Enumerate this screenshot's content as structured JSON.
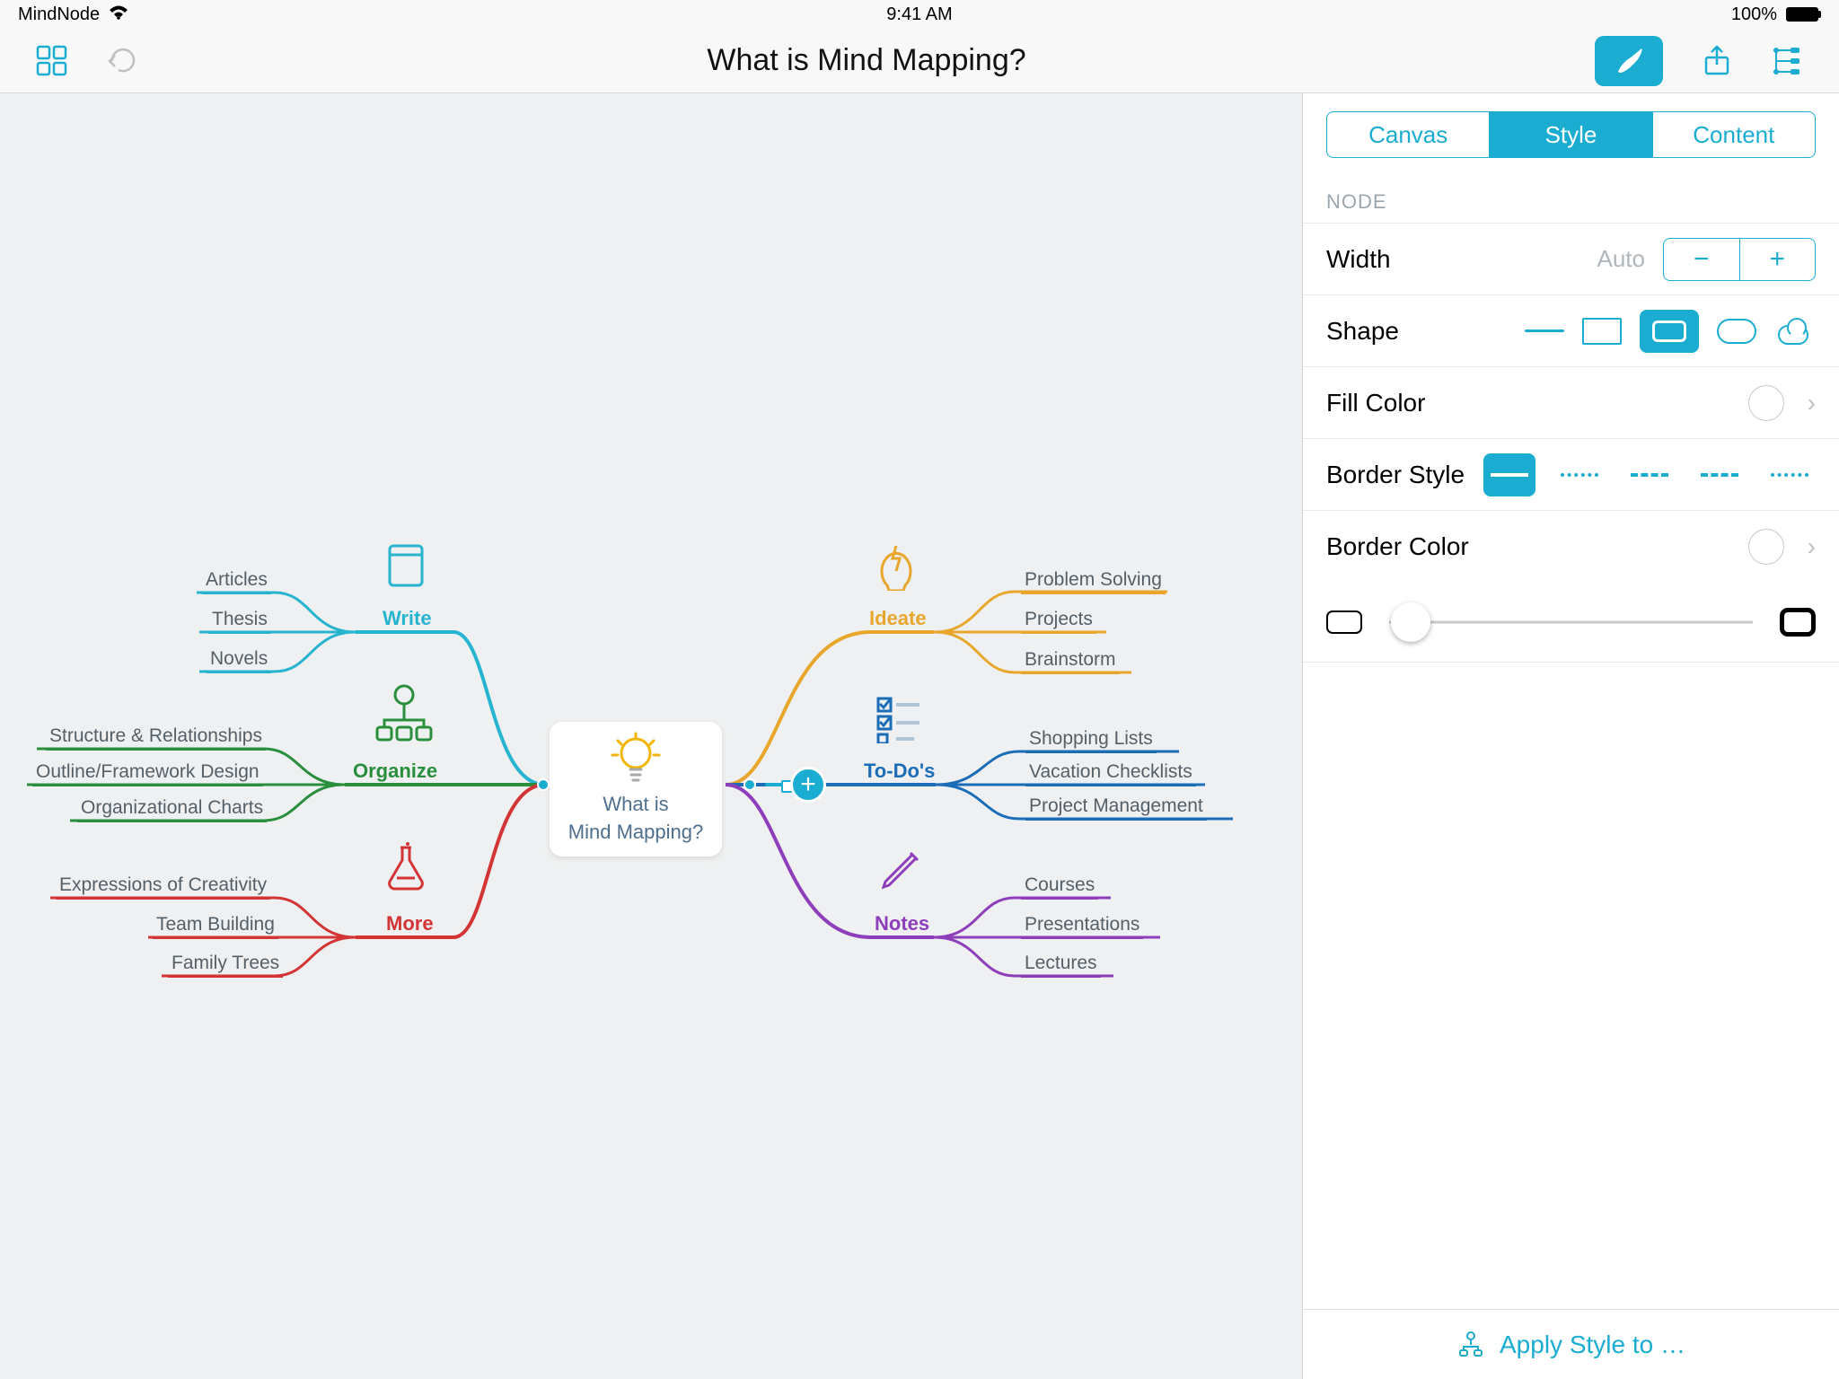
{
  "statusbar": {
    "app_name": "MindNode",
    "time": "9:41 AM",
    "battery": "100%"
  },
  "toolbar": {
    "title": "What is Mind Mapping?"
  },
  "inspector": {
    "tabs": [
      "Canvas",
      "Style",
      "Content"
    ],
    "selected_tab": "Style",
    "section": "NODE",
    "width_label": "Width",
    "width_value": "Auto",
    "shape_label": "Shape",
    "fill_label": "Fill Color",
    "border_style_label": "Border Style",
    "border_color_label": "Border Color",
    "apply_label": "Apply Style to …"
  },
  "mindmap": {
    "central": {
      "line1": "What is",
      "line2": "Mind Mapping?"
    },
    "branches": [
      {
        "id": "ideate",
        "side": "right",
        "label": "Ideate",
        "leaves": [
          "Problem Solving",
          "Projects",
          "Brainstorm"
        ]
      },
      {
        "id": "todos",
        "side": "right",
        "label": "To-Do's",
        "leaves": [
          "Shopping Lists",
          "Vacation Checklists",
          "Project Management"
        ]
      },
      {
        "id": "notes",
        "side": "right",
        "label": "Notes",
        "leaves": [
          "Courses",
          "Presentations",
          "Lectures"
        ]
      },
      {
        "id": "write",
        "side": "left",
        "label": "Write",
        "leaves": [
          "Articles",
          "Thesis",
          "Novels"
        ]
      },
      {
        "id": "organize",
        "side": "left",
        "label": "Organize",
        "leaves": [
          "Structure & Relationships",
          "Outline/Framework Design",
          "Organizational Charts"
        ]
      },
      {
        "id": "more",
        "side": "left",
        "label": "More",
        "leaves": [
          "Expressions of Creativity",
          "Team Building",
          "Family Trees"
        ]
      }
    ]
  }
}
